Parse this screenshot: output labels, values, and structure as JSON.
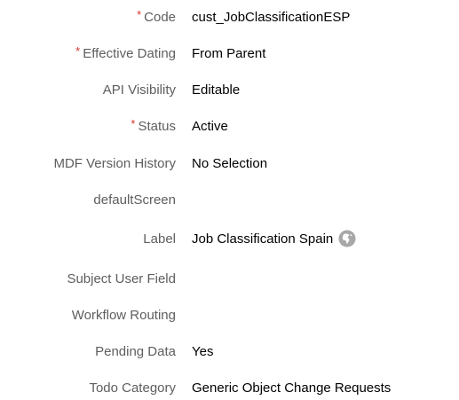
{
  "fields": [
    {
      "label": "Code",
      "required": true,
      "value": "cust_JobClassificationESP"
    },
    {
      "label": "Effective Dating",
      "required": true,
      "value": "From Parent"
    },
    {
      "label": "API Visibility",
      "required": false,
      "value": "Editable"
    },
    {
      "label": "Status",
      "required": true,
      "value": "Active"
    },
    {
      "label": "MDF Version History",
      "required": false,
      "value": "No Selection"
    },
    {
      "label": "defaultScreen",
      "required": false,
      "value": ""
    },
    {
      "label": "Label",
      "required": false,
      "value": "Job Classification Spain",
      "icon": "globe-icon"
    },
    {
      "label": "Subject User Field",
      "required": false,
      "value": ""
    },
    {
      "label": "Workflow Routing",
      "required": false,
      "value": ""
    },
    {
      "label": "Pending Data",
      "required": false,
      "value": "Yes"
    },
    {
      "label": "Todo Category",
      "required": false,
      "value": "Generic Object Change Requests"
    }
  ],
  "required_marker": "*",
  "colors": {
    "label": "#5e5e5e",
    "value": "#000000",
    "required": "#d9322c",
    "icon": "#a8a8a8"
  }
}
